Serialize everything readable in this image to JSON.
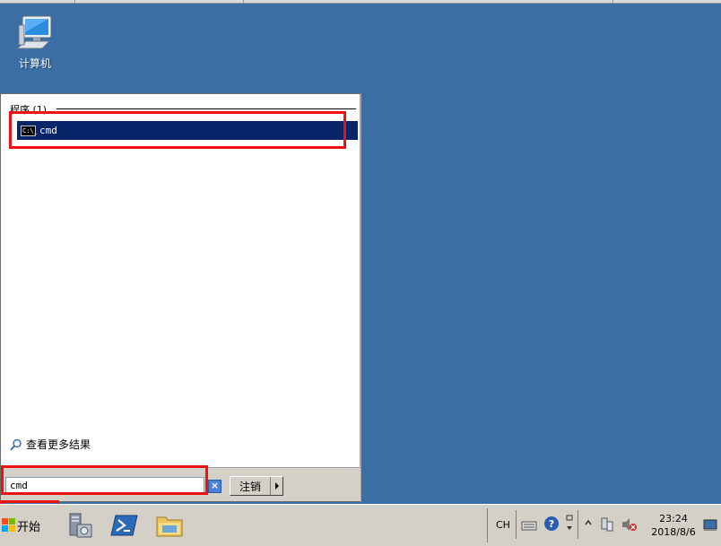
{
  "desktop": {
    "computer_icon": {
      "icon": "computer-icon",
      "label": "计算机"
    }
  },
  "start_menu": {
    "section_title": "程序 (1)",
    "results": [
      {
        "icon": "cmd-icon",
        "label": "cmd"
      }
    ],
    "see_more": "查看更多结果",
    "search": {
      "value": "cmd"
    },
    "logoff_label": "注销"
  },
  "taskbar": {
    "start_label": "开始",
    "quick_launch": [
      "server-manager-icon",
      "powershell-icon",
      "explorer-icon"
    ],
    "tray": {
      "language": "CH",
      "time": "23:24",
      "date": "2018/8/6"
    }
  },
  "colors": {
    "desktop": "#3a6ea5",
    "selection": "#0a246a",
    "highlight": "#ee1111"
  }
}
